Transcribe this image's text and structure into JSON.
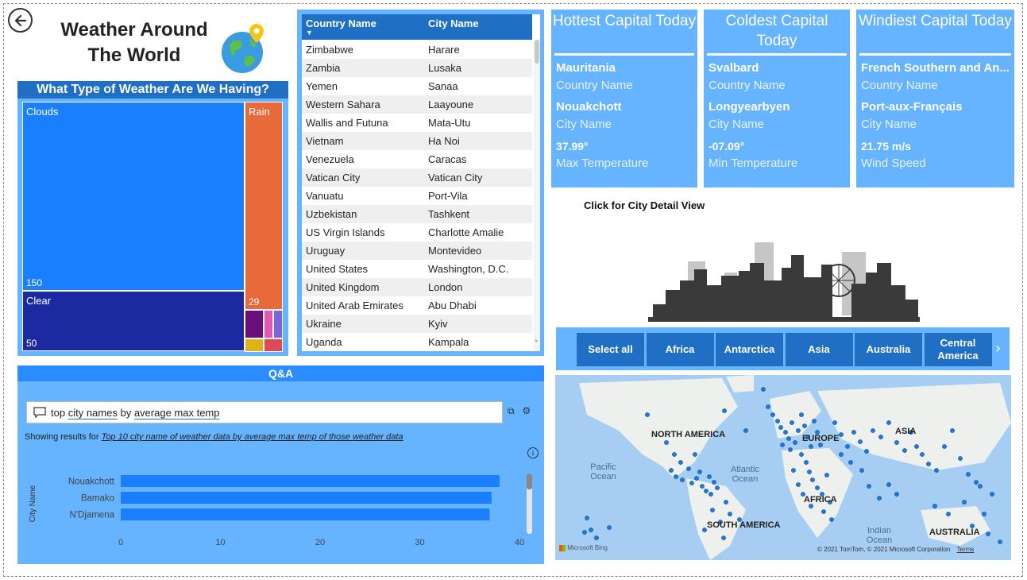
{
  "page": {
    "title_line1": "Weather Around",
    "title_line2": "The World"
  },
  "treemap": {
    "header": "What Type of Weather Are We Having?",
    "tiles": [
      {
        "label": "Clouds",
        "value": "150",
        "color": "#1a7fff"
      },
      {
        "label": "Clear",
        "value": "50",
        "color": "#1b2aa0"
      },
      {
        "label": "Rain",
        "value": "29",
        "color": "#e8693a"
      },
      {
        "label": "",
        "value": "",
        "color": "#6b0f7a"
      },
      {
        "label": "",
        "value": "",
        "color": "#e356b4"
      },
      {
        "label": "",
        "value": "",
        "color": "#7b63e0"
      },
      {
        "label": "",
        "value": "",
        "color": "#e0b21a"
      },
      {
        "label": "",
        "value": "",
        "color": "#e04858"
      }
    ]
  },
  "table": {
    "col1": "Country Name",
    "col2": "City Name",
    "rows": [
      [
        "Zimbabwe",
        "Harare"
      ],
      [
        "Zambia",
        "Lusaka"
      ],
      [
        "Yemen",
        "Sanaa"
      ],
      [
        "Western Sahara",
        "Laayoune"
      ],
      [
        "Wallis and Futuna",
        "Mata-Utu"
      ],
      [
        "Vietnam",
        "Ha Noi"
      ],
      [
        "Venezuela",
        "Caracas"
      ],
      [
        "Vatican City",
        "Vatican City"
      ],
      [
        "Vanuatu",
        "Port-Vila"
      ],
      [
        "Uzbekistan",
        "Tashkent"
      ],
      [
        "US Virgin Islands",
        "Charlotte Amalie"
      ],
      [
        "Uruguay",
        "Montevideo"
      ],
      [
        "United States",
        "Washington, D.C."
      ],
      [
        "United Kingdom",
        "London"
      ],
      [
        "United Arab Emirates",
        "Abu Dhabi"
      ],
      [
        "Ukraine",
        "Kyiv"
      ],
      [
        "Uganda",
        "Kampala"
      ]
    ]
  },
  "cards": {
    "hottest": {
      "title": "Hottest Capital Today",
      "country": "Mauritania",
      "country_label": "Country Name",
      "city": "Nouakchott",
      "city_label": "City Name",
      "value": "37.99°",
      "value_label": "Max Temperature"
    },
    "coldest": {
      "title": "Coldest Capital Today",
      "country": "Svalbard",
      "country_label": "Country Name",
      "city": "Longyearbyen",
      "city_label": "City Name",
      "value": "-07.09°",
      "value_label": "Min Temperature"
    },
    "windiest": {
      "title": "Windiest Capital Today",
      "country": "French Southern and An...",
      "country_label": "Country Name",
      "city": "Port-aux-Français",
      "city_label": "City Name",
      "value": "21.75 m/s",
      "value_label": "Wind Speed"
    }
  },
  "detail_link": "Click for City Detail View",
  "slicer": {
    "buttons": [
      "Select all",
      "Africa",
      "Antarctica",
      "Asia",
      "Australia",
      "Central America"
    ]
  },
  "map": {
    "labels": [
      "NORTH AMERICA",
      "EUROPE",
      "ASIA",
      "AFRICA",
      "SOUTH AMERICA",
      "AUSTRALIA"
    ],
    "oceans": [
      "Pacific Ocean",
      "Atlantic Ocean",
      "Indian Ocean"
    ],
    "credit": "© 2021 TomTom, © 2021 Microsoft Corporation",
    "terms": "Terms",
    "provider": "Microsoft Bing",
    "dot_color": "#1f7ae0"
  },
  "qa": {
    "header": "Q&A",
    "query_words": [
      "top",
      "city names",
      "by",
      "average max temp"
    ],
    "result_prefix": "Showing results for",
    "result_link": "Top 10 city name of weather data by average max temp of those weather data",
    "chart_data": {
      "type": "bar",
      "orientation": "horizontal",
      "ylabel": "City Name",
      "categories": [
        "Nouakchott",
        "Bamako",
        "N'Djamena"
      ],
      "values": [
        38.0,
        37.2,
        37.0
      ],
      "xlim": [
        0,
        40
      ],
      "xticks": [
        "0",
        "10",
        "20",
        "30",
        "40"
      ],
      "bar_color": "#1a7fff"
    }
  }
}
